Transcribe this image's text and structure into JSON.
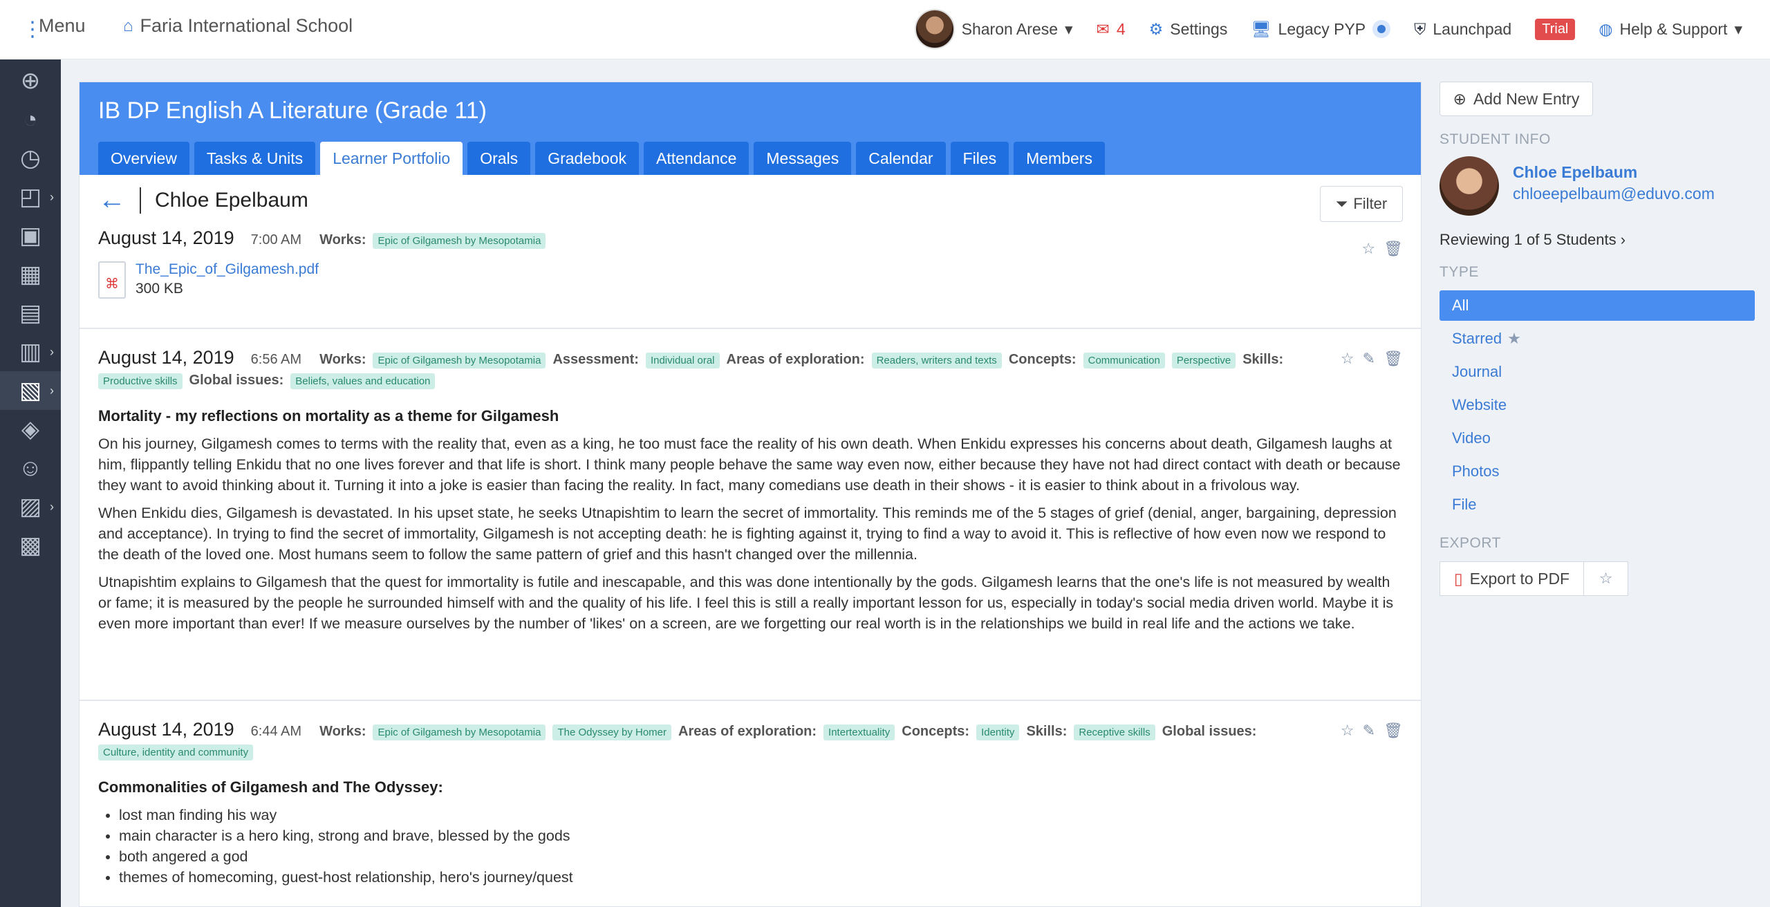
{
  "topbar": {
    "menu_label": "Menu",
    "school_name": "Faria International School",
    "user_name": "Sharon Arese",
    "mail_count": "4",
    "settings": "Settings",
    "legacy": "Legacy PYP",
    "launchpad": "Launchpad",
    "trial": "Trial",
    "help": "Help & Support"
  },
  "course": {
    "title": "IB DP English A Literature (Grade 11)",
    "tabs": [
      "Overview",
      "Tasks & Units",
      "Learner Portfolio",
      "Orals",
      "Gradebook",
      "Attendance",
      "Messages",
      "Calendar",
      "Files",
      "Members"
    ],
    "active_tab": "Learner Portfolio",
    "student_name": "Chloe Epelbaum",
    "filter_label": "Filter"
  },
  "entries": [
    {
      "date": "August 14, 2019",
      "time": "7:00 AM",
      "works_label": "Works:",
      "works": [
        "Epic of Gilgamesh by Mesopotamia"
      ],
      "file_name": "The_Epic_of_Gilgamesh.pdf",
      "file_size": "300 KB"
    },
    {
      "date": "August 14, 2019",
      "time": "6:56 AM",
      "works_label": "Works:",
      "works": [
        "Epic of Gilgamesh by Mesopotamia"
      ],
      "assessment_label": "Assessment:",
      "assessment": [
        "Individual oral"
      ],
      "areas_label": "Areas of exploration:",
      "areas": [
        "Readers, writers and texts"
      ],
      "concepts_label": "Concepts:",
      "concepts": [
        "Communication",
        "Perspective"
      ],
      "skills_label": "Skills:",
      "skills": [
        "Productive skills"
      ],
      "global_label": "Global issues:",
      "global": [
        "Beliefs, values and education"
      ],
      "title": "Mortality - my reflections on mortality as a theme for Gilgamesh",
      "paragraphs": [
        "On his journey, Gilgamesh comes to terms with the reality that, even as a king, he too must face the reality of his own death. When Enkidu expresses his concerns about death, Gilgamesh laughs at him, flippantly telling Enkidu that no one lives forever and that life is short. I think many people behave the same way even now, either because they have not had direct contact with death or because they want to avoid thinking about it. Turning it into a joke is easier than facing the reality. In fact, many comedians use death in their shows - it is easier to think about in a frivolous way.",
        "When Enkidu dies, Gilgamesh is devastated. In his upset state, he seeks Utnapishtim to learn the secret of immortality. This reminds me of the 5 stages of grief (denial, anger, bargaining, depression and acceptance). In trying to find the secret of immortality, Gilgamesh is not accepting death: he is fighting against it, trying to find a way to avoid it. This is reflective of how even now we respond to the death of the loved one. Most humans seem to follow the same pattern of grief and this hasn't changed over the millennia.",
        "Utnapishtim explains to Gilgamesh that the quest for immortality is futile and inescapable, and this was done intentionally by the gods. Gilgamesh learns that the one's life is not measured by wealth or fame; it is measured by the people he surrounded himself with and the quality of his life. I feel this is still a really important lesson for us, especially in today's social media driven world. Maybe it is even more important than ever! If we measure ourselves by the number of 'likes' on a screen, are we forgetting our real worth is in the relationships we build in real life and the actions we take."
      ]
    },
    {
      "date": "August 14, 2019",
      "time": "6:44 AM",
      "works_label": "Works:",
      "works": [
        "Epic of Gilgamesh by Mesopotamia",
        "The Odyssey by Homer"
      ],
      "areas_label": "Areas of exploration:",
      "areas": [
        "Intertextuality"
      ],
      "concepts_label": "Concepts:",
      "concepts": [
        "Identity"
      ],
      "skills_label": "Skills:",
      "skills": [
        "Receptive skills"
      ],
      "global_label": "Global issues:",
      "global": [
        "Culture, identity and community"
      ],
      "title": "Commonalities of Gilgamesh and The Odyssey:",
      "bullets": [
        "lost man finding his way",
        "main character is a hero king, strong and brave, blessed by the gods",
        "both angered a god",
        "themes of homecoming, guest-host relationship, hero's journey/quest"
      ]
    }
  ],
  "sidebar": {
    "add_entry": "Add New Entry",
    "student_info_label": "STUDENT INFO",
    "student_name": "Chloe Epelbaum",
    "student_email": "chloeepelbaum@eduvo.com",
    "reviewing": "Reviewing 1 of 5 Students",
    "type_label": "TYPE",
    "types": [
      "All",
      "Starred",
      "Journal",
      "Website",
      "Video",
      "Photos",
      "File"
    ],
    "export_label": "EXPORT",
    "export_btn": "Export to PDF"
  },
  "colors": {
    "accent": "#4a8df0",
    "tab": "#1f6fe0",
    "rail": "#2d3544",
    "tag_bg": "#cdeee6",
    "tag_fg": "#2a8a6e",
    "trial": "#e24c4c"
  }
}
